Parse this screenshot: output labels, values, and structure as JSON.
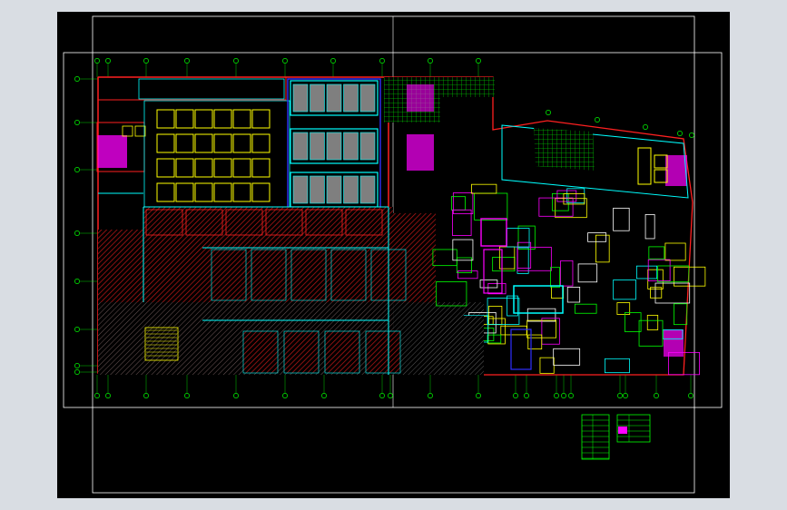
{
  "drawing": {
    "background": "#000000",
    "frame_color": "#ffffff",
    "colors": {
      "red": "#ff2020",
      "yellow": "#ffff00",
      "cyan": "#00ffff",
      "green": "#00ff00",
      "magenta": "#ff00ff",
      "blue": "#3030ff",
      "white": "#ffffff",
      "gray": "#808080",
      "orange": "#ff8040"
    },
    "grid_markers_top": [
      "",
      "",
      "",
      "",
      "",
      "",
      "",
      "",
      "",
      "",
      ""
    ],
    "grid_markers_bottom": [
      "",
      "",
      "",
      "",
      "",
      "",
      "",
      "",
      "",
      "",
      "",
      "",
      "",
      "",
      "",
      "",
      "",
      "",
      "",
      "",
      "",
      "",
      ""
    ],
    "legend_tables": 2
  }
}
